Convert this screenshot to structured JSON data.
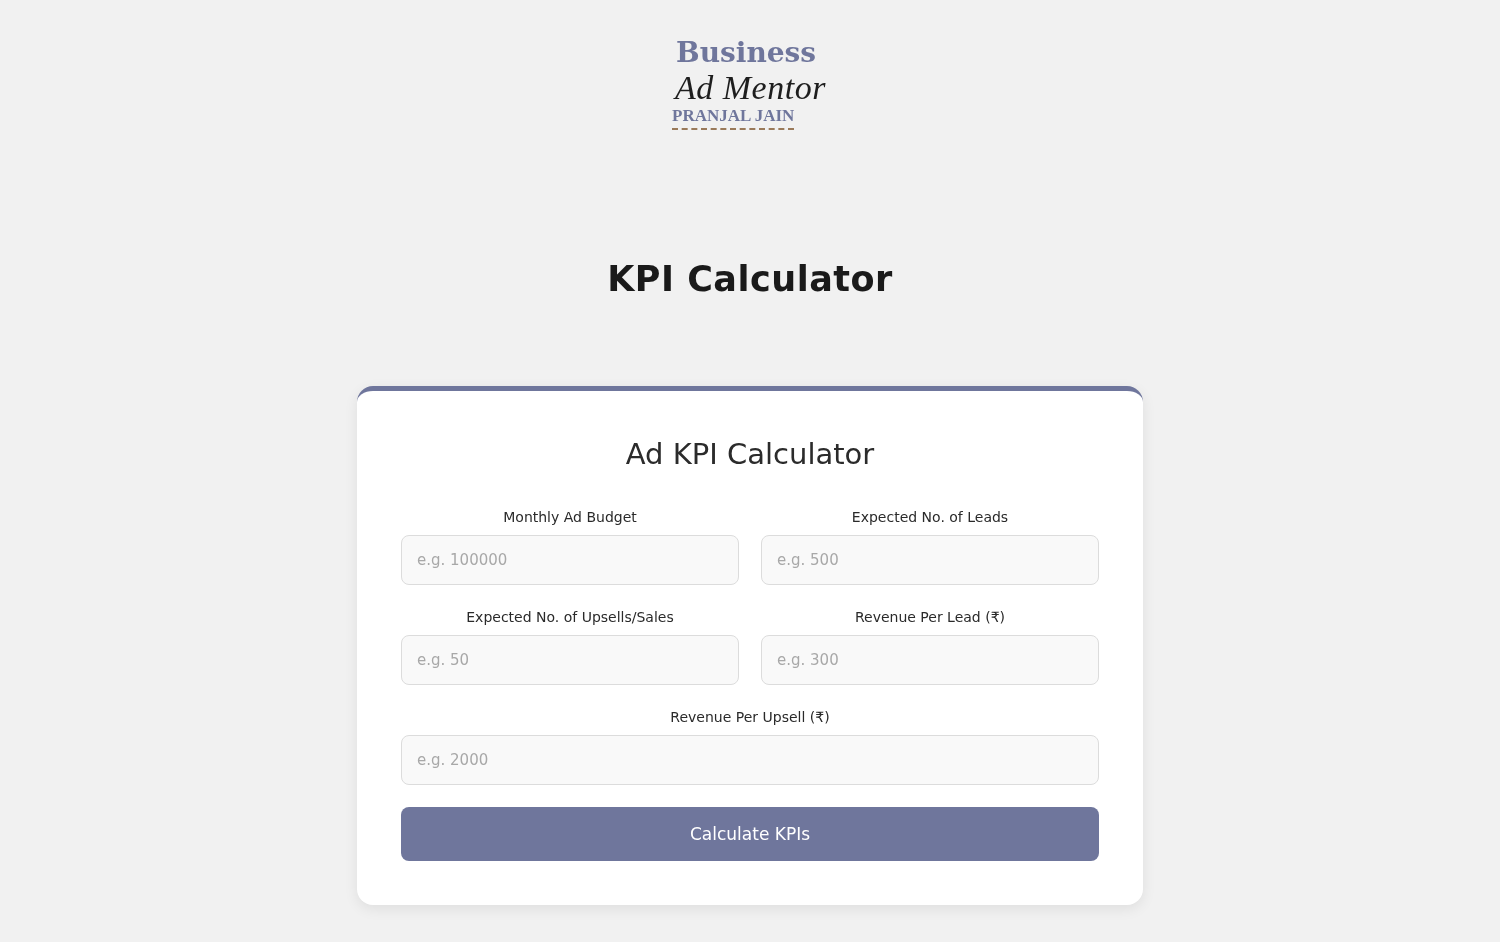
{
  "logo": {
    "title": "Business",
    "subtitle": "Ad Mentor",
    "name": "PRANJAL JAIN"
  },
  "page_title": "KPI Calculator",
  "card": {
    "heading": "Ad KPI Calculator",
    "fields": [
      {
        "kind": "half",
        "label": "Monthly Ad Budget",
        "placeholder": "e.g. 100000"
      },
      {
        "kind": "half",
        "label": "Expected No. of Leads",
        "placeholder": "e.g. 500"
      },
      {
        "kind": "half",
        "label": "Expected No. of Upsells/Sales",
        "placeholder": "e.g. 50"
      },
      {
        "kind": "half",
        "label": "Revenue Per Lead (₹)",
        "placeholder": "e.g. 300"
      },
      {
        "kind": "full",
        "label": "Revenue Per Upsell (₹)",
        "placeholder": "e.g. 2000"
      }
    ],
    "button": "Calculate KPIs"
  }
}
